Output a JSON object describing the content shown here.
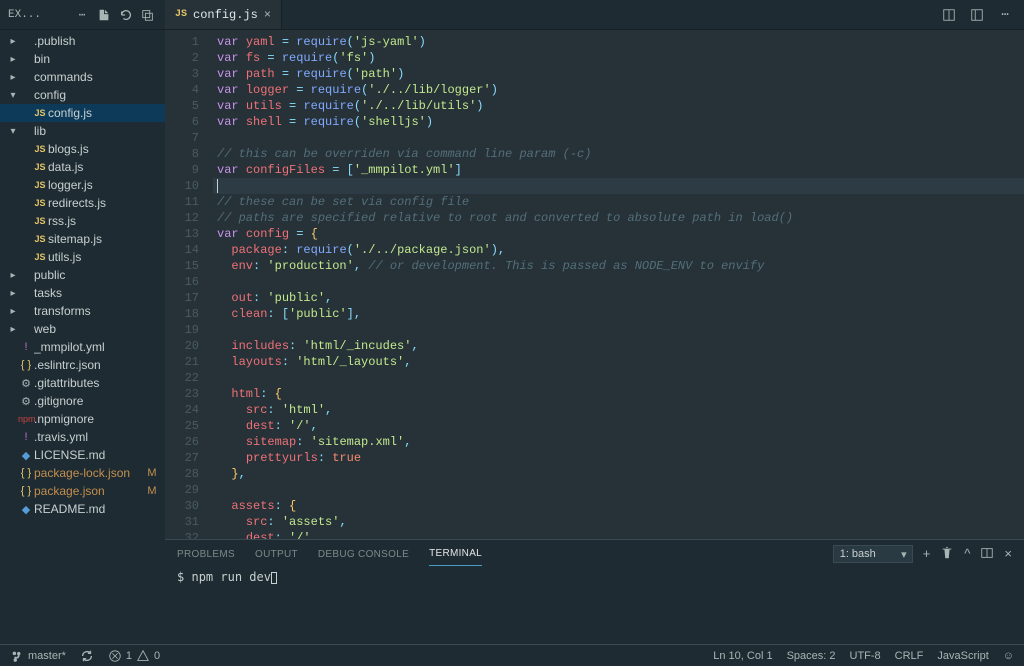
{
  "explorer": {
    "title": "EX..."
  },
  "tab": {
    "icon": "JS",
    "label": "config.js"
  },
  "sidebar": [
    {
      "depth": 0,
      "chev": "right",
      "icon": "folder",
      "label": ".publish"
    },
    {
      "depth": 0,
      "chev": "right",
      "icon": "folder",
      "label": "bin"
    },
    {
      "depth": 0,
      "chev": "right",
      "icon": "folder",
      "label": "commands"
    },
    {
      "depth": 0,
      "chev": "down",
      "icon": "folder",
      "label": "config"
    },
    {
      "depth": 1,
      "icon": "js",
      "label": "config.js",
      "selected": true
    },
    {
      "depth": 0,
      "chev": "down",
      "icon": "folder",
      "label": "lib"
    },
    {
      "depth": 1,
      "icon": "js",
      "label": "blogs.js"
    },
    {
      "depth": 1,
      "icon": "js",
      "label": "data.js"
    },
    {
      "depth": 1,
      "icon": "js",
      "label": "logger.js"
    },
    {
      "depth": 1,
      "icon": "js",
      "label": "redirects.js"
    },
    {
      "depth": 1,
      "icon": "js",
      "label": "rss.js"
    },
    {
      "depth": 1,
      "icon": "js",
      "label": "sitemap.js"
    },
    {
      "depth": 1,
      "icon": "js",
      "label": "utils.js"
    },
    {
      "depth": 0,
      "chev": "right",
      "icon": "folder",
      "label": "public"
    },
    {
      "depth": 0,
      "chev": "right",
      "icon": "folder",
      "label": "tasks"
    },
    {
      "depth": 0,
      "chev": "right",
      "icon": "folder",
      "label": "transforms"
    },
    {
      "depth": 0,
      "chev": "right",
      "icon": "folder",
      "label": "web"
    },
    {
      "depth": 0,
      "icon": "yml",
      "label": "_mmpilot.yml"
    },
    {
      "depth": 0,
      "icon": "json",
      "label": ".eslintrc.json"
    },
    {
      "depth": 0,
      "icon": "file",
      "label": ".gitattributes"
    },
    {
      "depth": 0,
      "icon": "file",
      "label": ".gitignore"
    },
    {
      "depth": 0,
      "icon": "npm",
      "label": ".npmignore"
    },
    {
      "depth": 0,
      "icon": "yml",
      "label": ".travis.yml"
    },
    {
      "depth": 0,
      "icon": "md",
      "label": "LICENSE.md"
    },
    {
      "depth": 0,
      "icon": "json",
      "label": "package-lock.json",
      "status": "M",
      "git": true
    },
    {
      "depth": 0,
      "icon": "json",
      "label": "package.json",
      "status": "M",
      "git": true
    },
    {
      "depth": 0,
      "icon": "md",
      "label": "README.md"
    }
  ],
  "code": [
    [
      [
        "kw",
        "var"
      ],
      [
        "txt",
        " "
      ],
      [
        "var",
        "yaml"
      ],
      [
        "txt",
        " "
      ],
      [
        "op",
        "="
      ],
      [
        "txt",
        " "
      ],
      [
        "fn",
        "require"
      ],
      [
        "punc",
        "("
      ],
      [
        "str",
        "'js-yaml'"
      ],
      [
        "punc",
        ")"
      ]
    ],
    [
      [
        "kw",
        "var"
      ],
      [
        "txt",
        " "
      ],
      [
        "var",
        "fs"
      ],
      [
        "txt",
        " "
      ],
      [
        "op",
        "="
      ],
      [
        "txt",
        " "
      ],
      [
        "fn",
        "require"
      ],
      [
        "punc",
        "("
      ],
      [
        "str",
        "'fs'"
      ],
      [
        "punc",
        ")"
      ]
    ],
    [
      [
        "kw",
        "var"
      ],
      [
        "txt",
        " "
      ],
      [
        "var",
        "path"
      ],
      [
        "txt",
        " "
      ],
      [
        "op",
        "="
      ],
      [
        "txt",
        " "
      ],
      [
        "fn",
        "require"
      ],
      [
        "punc",
        "("
      ],
      [
        "str",
        "'path'"
      ],
      [
        "punc",
        ")"
      ]
    ],
    [
      [
        "kw",
        "var"
      ],
      [
        "txt",
        " "
      ],
      [
        "var",
        "logger"
      ],
      [
        "txt",
        " "
      ],
      [
        "op",
        "="
      ],
      [
        "txt",
        " "
      ],
      [
        "fn",
        "require"
      ],
      [
        "punc",
        "("
      ],
      [
        "str",
        "'./../lib/logger'"
      ],
      [
        "punc",
        ")"
      ]
    ],
    [
      [
        "kw",
        "var"
      ],
      [
        "txt",
        " "
      ],
      [
        "var",
        "utils"
      ],
      [
        "txt",
        " "
      ],
      [
        "op",
        "="
      ],
      [
        "txt",
        " "
      ],
      [
        "fn",
        "require"
      ],
      [
        "punc",
        "("
      ],
      [
        "str",
        "'./../lib/utils'"
      ],
      [
        "punc",
        ")"
      ]
    ],
    [
      [
        "kw",
        "var"
      ],
      [
        "txt",
        " "
      ],
      [
        "var",
        "shell"
      ],
      [
        "txt",
        " "
      ],
      [
        "op",
        "="
      ],
      [
        "txt",
        " "
      ],
      [
        "fn",
        "require"
      ],
      [
        "punc",
        "("
      ],
      [
        "str",
        "'shelljs'"
      ],
      [
        "punc",
        ")"
      ]
    ],
    [],
    [
      [
        "comment",
        "// this can be overriden via command line param (-c)"
      ]
    ],
    [
      [
        "kw",
        "var"
      ],
      [
        "txt",
        " "
      ],
      [
        "var",
        "configFiles"
      ],
      [
        "txt",
        " "
      ],
      [
        "op",
        "="
      ],
      [
        "txt",
        " "
      ],
      [
        "punc",
        "["
      ],
      [
        "str",
        "'_mmpilot.yml'"
      ],
      [
        "punc",
        "]"
      ]
    ],
    [
      [
        "cursor",
        ""
      ]
    ],
    [
      [
        "comment",
        "// these can be set via config file"
      ]
    ],
    [
      [
        "comment",
        "// paths are specified relative to root and converted to absolute path in load()"
      ]
    ],
    [
      [
        "kw",
        "var"
      ],
      [
        "txt",
        " "
      ],
      [
        "var",
        "config"
      ],
      [
        "txt",
        " "
      ],
      [
        "op",
        "="
      ],
      [
        "txt",
        " "
      ],
      [
        "brace",
        "{"
      ]
    ],
    [
      [
        "txt",
        "  "
      ],
      [
        "var",
        "package"
      ],
      [
        "punc",
        ":"
      ],
      [
        "txt",
        " "
      ],
      [
        "fn",
        "require"
      ],
      [
        "punc",
        "("
      ],
      [
        "str",
        "'./../package.json'"
      ],
      [
        "punc",
        "),"
      ]
    ],
    [
      [
        "txt",
        "  "
      ],
      [
        "var",
        "env"
      ],
      [
        "punc",
        ":"
      ],
      [
        "txt",
        " "
      ],
      [
        "str",
        "'production'"
      ],
      [
        "punc",
        ","
      ],
      [
        "txt",
        " "
      ],
      [
        "comment",
        "// or development. This is passed as NODE_ENV to envify"
      ]
    ],
    [],
    [
      [
        "txt",
        "  "
      ],
      [
        "var",
        "out"
      ],
      [
        "punc",
        ":"
      ],
      [
        "txt",
        " "
      ],
      [
        "str",
        "'public'"
      ],
      [
        "punc",
        ","
      ]
    ],
    [
      [
        "txt",
        "  "
      ],
      [
        "var",
        "clean"
      ],
      [
        "punc",
        ":"
      ],
      [
        "txt",
        " "
      ],
      [
        "punc",
        "["
      ],
      [
        "str",
        "'public'"
      ],
      [
        "punc",
        "],"
      ]
    ],
    [],
    [
      [
        "txt",
        "  "
      ],
      [
        "var",
        "includes"
      ],
      [
        "punc",
        ":"
      ],
      [
        "txt",
        " "
      ],
      [
        "str",
        "'html/_incudes'"
      ],
      [
        "punc",
        ","
      ]
    ],
    [
      [
        "txt",
        "  "
      ],
      [
        "var",
        "layouts"
      ],
      [
        "punc",
        ":"
      ],
      [
        "txt",
        " "
      ],
      [
        "str",
        "'html/_layouts'"
      ],
      [
        "punc",
        ","
      ]
    ],
    [],
    [
      [
        "txt",
        "  "
      ],
      [
        "var",
        "html"
      ],
      [
        "punc",
        ":"
      ],
      [
        "txt",
        " "
      ],
      [
        "brace",
        "{"
      ]
    ],
    [
      [
        "txt",
        "    "
      ],
      [
        "var",
        "src"
      ],
      [
        "punc",
        ":"
      ],
      [
        "txt",
        " "
      ],
      [
        "str",
        "'html'"
      ],
      [
        "punc",
        ","
      ]
    ],
    [
      [
        "txt",
        "    "
      ],
      [
        "var",
        "dest"
      ],
      [
        "punc",
        ":"
      ],
      [
        "txt",
        " "
      ],
      [
        "str",
        "'/'"
      ],
      [
        "punc",
        ","
      ]
    ],
    [
      [
        "txt",
        "    "
      ],
      [
        "var",
        "sitemap"
      ],
      [
        "punc",
        ":"
      ],
      [
        "txt",
        " "
      ],
      [
        "str",
        "'sitemap.xml'"
      ],
      [
        "punc",
        ","
      ]
    ],
    [
      [
        "txt",
        "    "
      ],
      [
        "var",
        "prettyurls"
      ],
      [
        "punc",
        ":"
      ],
      [
        "txt",
        " "
      ],
      [
        "bool",
        "true"
      ]
    ],
    [
      [
        "txt",
        "  "
      ],
      [
        "brace",
        "}"
      ],
      [
        "punc",
        ","
      ]
    ],
    [],
    [
      [
        "txt",
        "  "
      ],
      [
        "var",
        "assets"
      ],
      [
        "punc",
        ":"
      ],
      [
        "txt",
        " "
      ],
      [
        "brace",
        "{"
      ]
    ],
    [
      [
        "txt",
        "    "
      ],
      [
        "var",
        "src"
      ],
      [
        "punc",
        ":"
      ],
      [
        "txt",
        " "
      ],
      [
        "str",
        "'assets'"
      ],
      [
        "punc",
        ","
      ]
    ],
    [
      [
        "txt",
        "    "
      ],
      [
        "var",
        "dest"
      ],
      [
        "punc",
        ":"
      ],
      [
        "txt",
        " "
      ],
      [
        "str",
        "'/'"
      ]
    ],
    [
      [
        "txt",
        "  "
      ],
      [
        "brace",
        "}"
      ],
      [
        "punc",
        ","
      ]
    ],
    [
      [
        "brace",
        ""
      ]
    ]
  ],
  "currentLine": 10,
  "panel": {
    "tabs": [
      "PROBLEMS",
      "OUTPUT",
      "DEBUG CONSOLE",
      "TERMINAL"
    ],
    "activeTab": 3,
    "termSelect": "1: bash"
  },
  "terminal": {
    "prompt": "$",
    "command": "npm run dev"
  },
  "status": {
    "branch": "master*",
    "errors": "1",
    "warnings": "0",
    "position": "Ln 10, Col 1",
    "spaces": "Spaces: 2",
    "encoding": "UTF-8",
    "eol": "CRLF",
    "language": "JavaScript"
  }
}
